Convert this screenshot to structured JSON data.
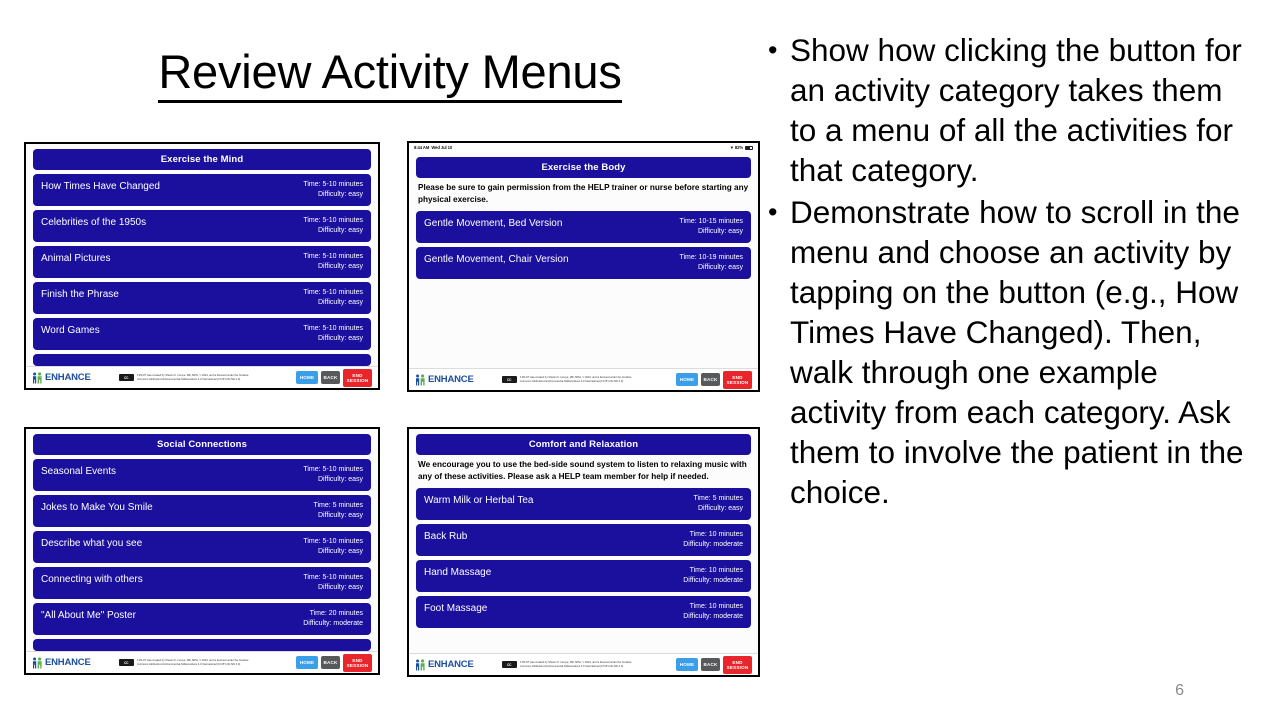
{
  "slide": {
    "title": "Review Activity Menus",
    "page_number": "6",
    "bullets": [
      "Show how clicking the button for an activity category takes them to a menu of all the activities for that category.",
      "Demonstrate how to scroll in the menu and choose an activity by tapping on the button (e.g.,  How Times Have Changed). Then, walk through one example activity from each category. Ask them to involve the patient in the choice."
    ],
    "bullet_marker": "•"
  },
  "colors": {
    "menu_blue": "#1b0f9e",
    "home_button": "#3a9fe8",
    "back_button": "#58595b",
    "end_session_button": "#e8252a",
    "logo_blue": "#1c4f9c",
    "page_number_gray": "#8a8a8a"
  },
  "footer": {
    "logo_text": "ENHANCE",
    "cc_badge": "CC",
    "cc_text": "A PILOT was created by Sharon K. Inouye, MD, MPH, © 2024, and is licensed under the Creative Commons Attribution-NonCommercial-NoDerivatives 4.0 International (CC BY-NC-ND 4.0).",
    "buttons": {
      "home": "HOME",
      "back": "BACK",
      "end_session": "END SESSION"
    }
  },
  "screenshots": [
    {
      "id": "exercise-the-mind",
      "header": "Exercise the Mind",
      "note": null,
      "status_bar": null,
      "home_indicator": false,
      "scroll_cut_row": true,
      "activities": [
        {
          "name": "How Times Have Changed",
          "time": "Time: 5-10 minutes",
          "difficulty": "Difficulty: easy"
        },
        {
          "name": "Celebrities of the 1950s",
          "time": "Time: 5-10 minutes",
          "difficulty": "Difficulty: easy"
        },
        {
          "name": "Animal Pictures",
          "time": "Time: 5-10 minutes",
          "difficulty": "Difficulty: easy"
        },
        {
          "name": "Finish the Phrase",
          "time": "Time: 5-10 minutes",
          "difficulty": "Difficulty: easy"
        },
        {
          "name": "Word Games",
          "time": "Time: 5-10 minutes",
          "difficulty": "Difficulty: easy"
        }
      ]
    },
    {
      "id": "exercise-the-body",
      "header": "Exercise the Body",
      "note": "Please be sure to gain permission from the HELP trainer or nurse before starting any physical exercise.",
      "status_bar": {
        "time": "8:44 AM",
        "date": "Wed Jul 10",
        "battery": "82%"
      },
      "home_indicator": true,
      "scroll_cut_row": false,
      "activities": [
        {
          "name": "Gentle Movement, Bed Version",
          "time": "Time: 10-15 minutes",
          "difficulty": "Difficulty: easy"
        },
        {
          "name": "Gentle Movement, Chair Version",
          "time": "Time: 10-19 minutes",
          "difficulty": "Difficulty: easy"
        }
      ]
    },
    {
      "id": "social-connections",
      "header": "Social Connections",
      "note": null,
      "status_bar": null,
      "home_indicator": false,
      "scroll_cut_row": true,
      "activities": [
        {
          "name": "Seasonal Events",
          "time": "Time: 5-10 minutes",
          "difficulty": "Difficulty: easy"
        },
        {
          "name": "Jokes to Make You Smile",
          "time": "Time: 5 minutes",
          "difficulty": "Difficulty: easy"
        },
        {
          "name": "Describe what you see",
          "time": "Time: 5-10 minutes",
          "difficulty": "Difficulty: easy"
        },
        {
          "name": "Connecting with others",
          "time": "Time: 5-10 minutes",
          "difficulty": "Difficulty: easy"
        },
        {
          "name": "\"All About Me\" Poster",
          "time": "Time: 20 minutes",
          "difficulty": "Difficulty: moderate"
        }
      ]
    },
    {
      "id": "comfort-and-relaxation",
      "header": "Comfort and Relaxation",
      "note": "We encourage you to use the bed-side sound system to listen to relaxing music with any of these activities. Please ask a HELP team member for help if needed.",
      "status_bar": null,
      "home_indicator": false,
      "scroll_cut_row": false,
      "activities": [
        {
          "name": "Warm Milk or Herbal Tea",
          "time": "Time: 5 minutes",
          "difficulty": "Difficulty: easy"
        },
        {
          "name": "Back Rub",
          "time": "Time: 10 minutes",
          "difficulty": "Difficulty: moderate"
        },
        {
          "name": "Hand Massage",
          "time": "Time: 10 minutes",
          "difficulty": "Difficulty: moderate"
        },
        {
          "name": "Foot Massage",
          "time": "Time: 10 minutes",
          "difficulty": "Difficulty: moderate"
        }
      ]
    }
  ]
}
